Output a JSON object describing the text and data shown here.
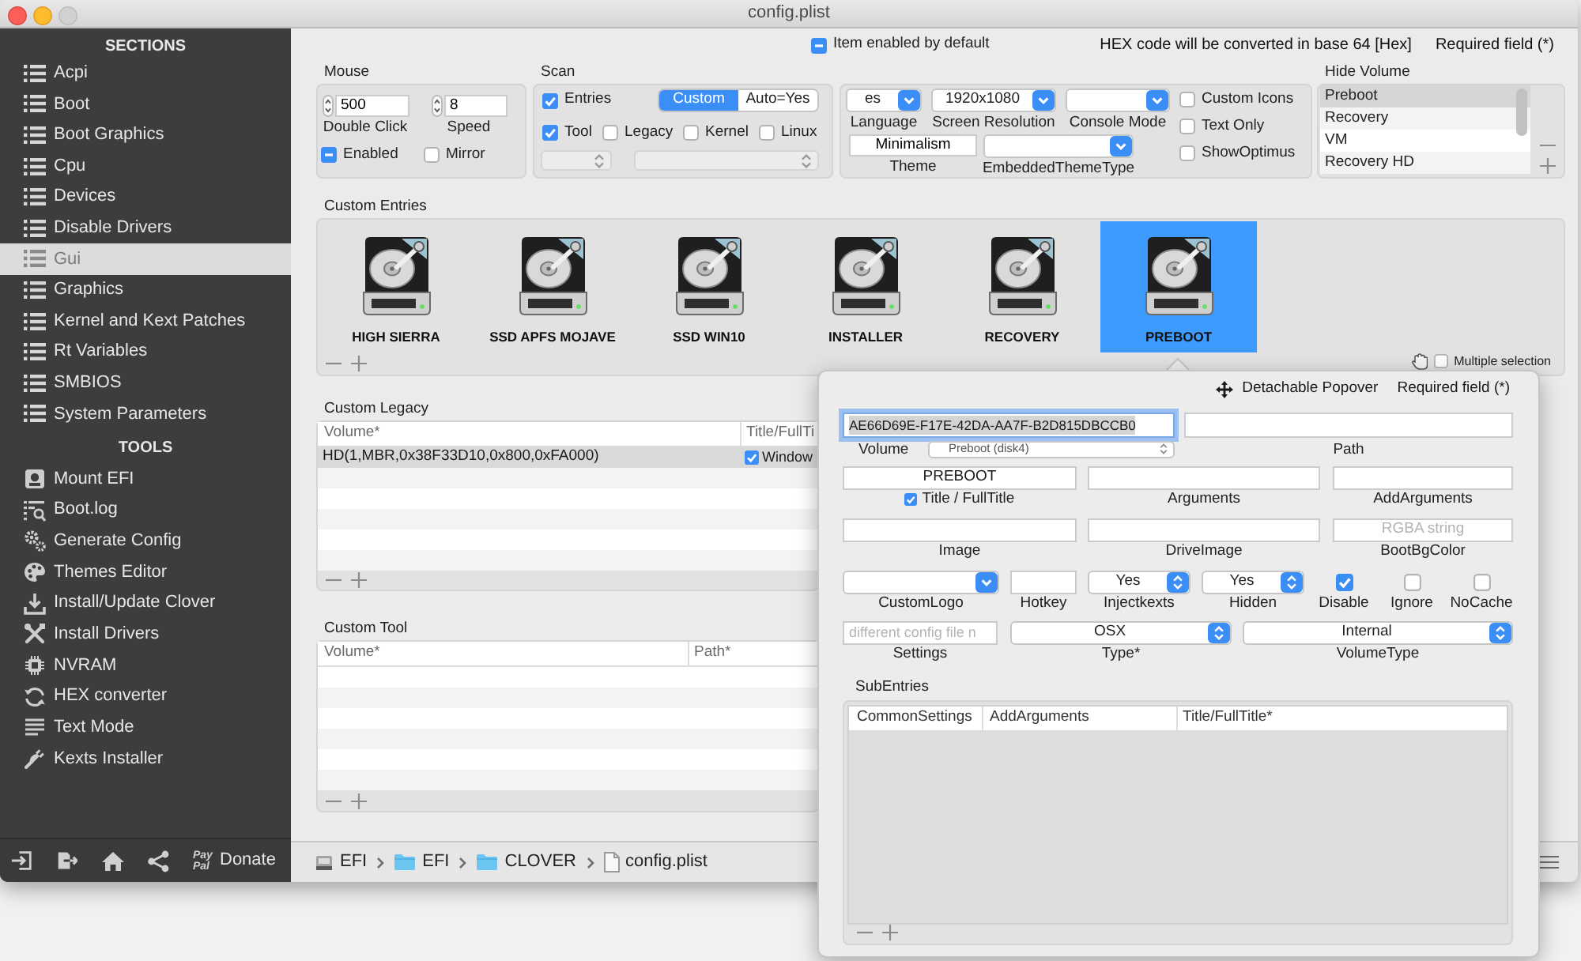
{
  "window": {
    "title": "config.plist"
  },
  "sidebar": {
    "sections_heading": "SECTIONS",
    "sections": [
      {
        "label": "Acpi",
        "selected": false
      },
      {
        "label": "Boot",
        "selected": false
      },
      {
        "label": "Boot Graphics",
        "selected": false
      },
      {
        "label": "Cpu",
        "selected": false
      },
      {
        "label": "Devices",
        "selected": false
      },
      {
        "label": "Disable Drivers",
        "selected": false
      },
      {
        "label": "Gui",
        "selected": true
      },
      {
        "label": "Graphics",
        "selected": false
      },
      {
        "label": "Kernel and Kext Patches",
        "selected": false
      },
      {
        "label": "Rt Variables",
        "selected": false
      },
      {
        "label": "SMBIOS",
        "selected": false
      },
      {
        "label": "System Parameters",
        "selected": false
      }
    ],
    "tools_heading": "TOOLS",
    "tools": [
      "Mount EFI",
      "Boot.log",
      "Generate Config",
      "Themes Editor",
      "Install/Update Clover",
      "Install Drivers",
      "NVRAM",
      "HEX converter",
      "Text Mode",
      "Kexts Installer"
    ],
    "footer": {
      "paypal_logo": "Pay Pal",
      "donate": "Donate"
    }
  },
  "header": {
    "item_enabled_by_default": {
      "label": "Item enabled by default",
      "checked": true,
      "mixed": true
    },
    "hex_note": "HEX code will be converted in base 64 [Hex]",
    "required_note": "Required field (*)"
  },
  "mouse": {
    "title": "Mouse",
    "double_click": {
      "value": "500",
      "label": "Double Click"
    },
    "speed": {
      "value": "8",
      "label": "Speed"
    },
    "enabled": {
      "label": "Enabled",
      "checked": true,
      "mixed": true
    },
    "mirror": {
      "label": "Mirror",
      "checked": false
    }
  },
  "scan": {
    "title": "Scan",
    "entries": {
      "label": "Entries",
      "checked": true
    },
    "segments": [
      {
        "label": "Custom",
        "selected": true
      },
      {
        "label": "Auto=Yes",
        "selected": false
      }
    ],
    "checkboxes": [
      {
        "label": "Tool",
        "checked": true
      },
      {
        "label": "Legacy",
        "checked": false
      },
      {
        "label": "Kernel",
        "checked": false
      },
      {
        "label": "Linux",
        "checked": false
      }
    ],
    "popups": [
      {
        "disabled": true
      },
      {
        "disabled": true
      }
    ]
  },
  "gui": {
    "language": {
      "value": "es",
      "label": "Language"
    },
    "screen_resolution": {
      "value": "1920x1080",
      "label": "Screen Resolution"
    },
    "console_mode": {
      "label": "Console Mode"
    },
    "theme": {
      "value": "Minimalism",
      "label": "Theme"
    },
    "embedded_theme_type": {
      "label": "EmbeddedThemeType"
    },
    "checkboxes": [
      {
        "label": "Custom Icons",
        "checked": false
      },
      {
        "label": "Text Only",
        "checked": false
      },
      {
        "label": "ShowOptimus",
        "checked": false
      }
    ]
  },
  "hide_volume": {
    "title": "Hide Volume",
    "items": [
      {
        "label": "Preboot",
        "selected": true
      },
      {
        "label": "Recovery",
        "selected": false
      },
      {
        "label": "VM",
        "selected": false
      },
      {
        "label": "Recovery HD",
        "selected": false
      }
    ]
  },
  "custom_entries": {
    "title": "Custom Entries",
    "entries": [
      {
        "label": "HIGH SIERRA",
        "selected": false
      },
      {
        "label": "SSD APFS MOJAVE",
        "selected": false
      },
      {
        "label": "SSD WIN10",
        "selected": false
      },
      {
        "label": "INSTALLER",
        "selected": false
      },
      {
        "label": "RECOVERY",
        "selected": false
      },
      {
        "label": "PREBOOT",
        "selected": true
      }
    ],
    "multiple_selection": {
      "label": "Multiple selection",
      "checked": false
    }
  },
  "custom_legacy": {
    "title": "Custom Legacy",
    "columns": [
      "Volume*",
      "Title/FullTi"
    ],
    "rows": [
      {
        "volume": "HD(1,MBR,0x38F33D10,0x800,0xFA000)",
        "title": "Window",
        "title_checked": true,
        "selected": true
      }
    ]
  },
  "custom_tool": {
    "title": "Custom Tool",
    "columns": [
      "Volume*",
      "Path*"
    ]
  },
  "path_bar": [
    {
      "label": "EFI",
      "kind": "drive"
    },
    {
      "label": "EFI",
      "kind": "folder"
    },
    {
      "label": "CLOVER",
      "kind": "folder"
    },
    {
      "label": "config.plist",
      "kind": "file"
    }
  ],
  "popover": {
    "detachable": "Detachable Popover",
    "required_note": "Required field (*)",
    "uuid": {
      "value": "AE66D69E-F17E-42DA-AA7F-B2D815DBCCB0",
      "focused": true
    },
    "volume": {
      "label": "Volume",
      "value": "Preboot (disk4)"
    },
    "path": {
      "label": "Path"
    },
    "title": {
      "value": "PREBOOT",
      "label": "Title / FullTitle",
      "checked": true
    },
    "arguments": {
      "label": "Arguments"
    },
    "add_arguments": {
      "label": "AddArguments"
    },
    "image": {
      "label": "Image"
    },
    "drive_image": {
      "label": "DriveImage"
    },
    "boot_bg_color": {
      "label": "BootBgColor",
      "placeholder": "RGBA string"
    },
    "custom_logo": {
      "label": "CustomLogo"
    },
    "hotkey": {
      "label": "Hotkey"
    },
    "inject_kexts": {
      "label": "Injectkexts",
      "value": "Yes"
    },
    "hidden": {
      "label": "Hidden",
      "value": "Yes"
    },
    "flags": [
      {
        "label": "Disable",
        "checked": true
      },
      {
        "label": "Ignore",
        "checked": false
      },
      {
        "label": "NoCache",
        "checked": false
      }
    ],
    "settings": {
      "label": "Settings",
      "placeholder": "different config file n"
    },
    "type": {
      "label": "Type*",
      "value": "OSX"
    },
    "volume_type": {
      "label": "VolumeType",
      "value": "Internal"
    },
    "sub_entries": {
      "title": "SubEntries",
      "columns": [
        "CommonSettings",
        "AddArguments",
        "Title/FullTitle*"
      ]
    }
  }
}
